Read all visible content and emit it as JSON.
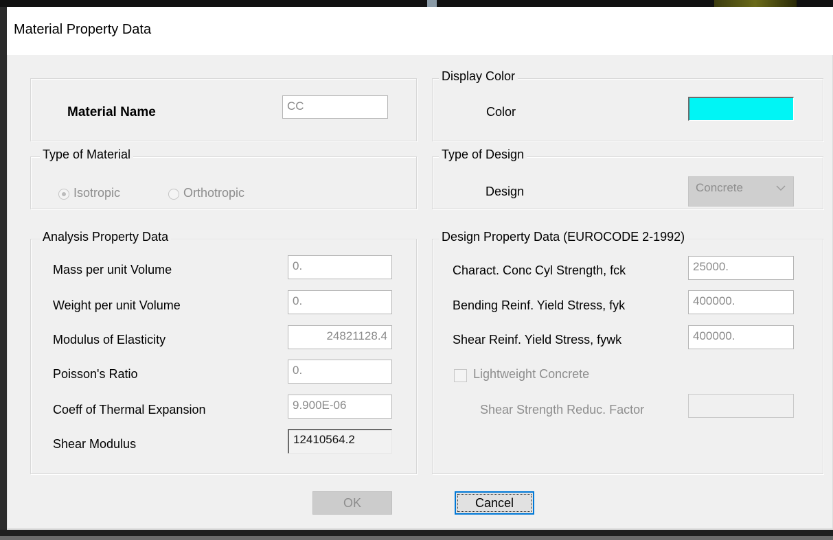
{
  "window": {
    "title": "Material Property Data"
  },
  "material_name": {
    "label": "Material Name",
    "value": "CC"
  },
  "display_color": {
    "group_title": "Display Color",
    "label": "Color",
    "color": "#00f5f5"
  },
  "type_of_material": {
    "group_title": "Type of Material",
    "options": [
      {
        "label": "Isotropic",
        "selected": true
      },
      {
        "label": "Orthotropic",
        "selected": false
      }
    ]
  },
  "type_of_design": {
    "group_title": "Type of Design",
    "label": "Design",
    "selected": "Concrete"
  },
  "analysis": {
    "group_title": "Analysis Property Data",
    "rows": [
      {
        "label": "Mass per unit Volume",
        "value": "0."
      },
      {
        "label": "Weight per unit Volume",
        "value": "0."
      },
      {
        "label": "Modulus of Elasticity",
        "value": "24821128.4"
      },
      {
        "label": "Poisson's Ratio",
        "value": "0."
      },
      {
        "label": "Coeff of Thermal Expansion",
        "value": "9.900E-06"
      },
      {
        "label": "Shear Modulus",
        "value": "12410564.2"
      }
    ]
  },
  "design_props": {
    "group_title": "Design Property Data (EUROCODE 2-1992)",
    "rows": [
      {
        "label": "Charact. Conc Cyl Strength, fck",
        "value": "25000."
      },
      {
        "label": "Bending Reinf. Yield Stress, fyk",
        "value": "400000."
      },
      {
        "label": "Shear Reinf. Yield Stress, fywk",
        "value": "400000."
      }
    ],
    "lightweight_label": "Lightweight Concrete",
    "shear_reduc_label": "Shear Strength Reduc. Factor",
    "shear_reduc_value": ""
  },
  "buttons": {
    "ok": "OK",
    "cancel": "Cancel"
  }
}
